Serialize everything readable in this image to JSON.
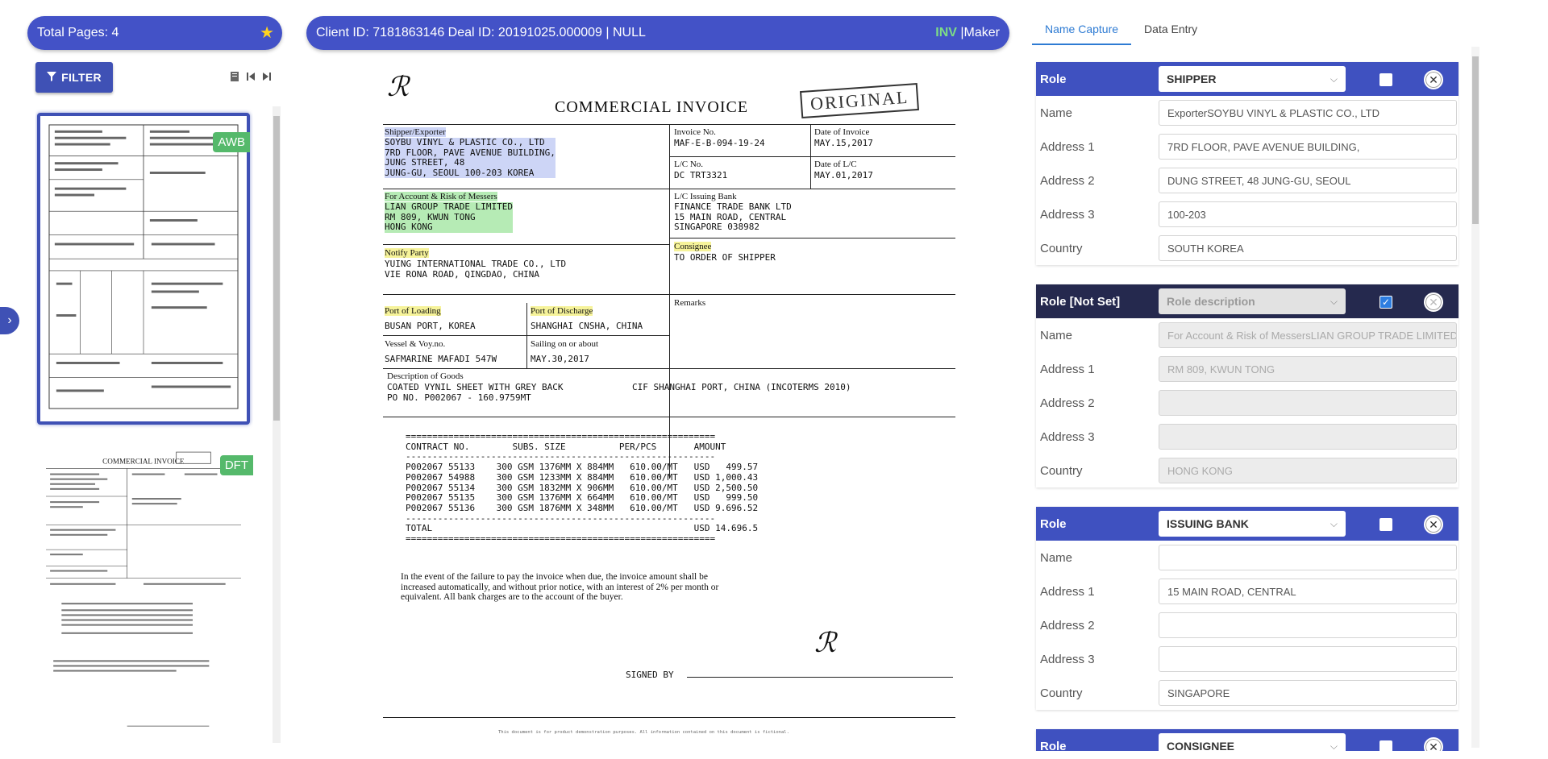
{
  "left": {
    "total_pages_label": "Total Pages: 4",
    "filter_label": "FILTER",
    "thumbnails": [
      {
        "badge": "AWB",
        "selected": true
      },
      {
        "badge": "DFT",
        "selected": false
      }
    ]
  },
  "header": {
    "client_info": "Client ID: 7181863146 Deal ID: 20191025.000009 | NULL",
    "doc_type": "INV",
    "separator": " |",
    "role": "Maker"
  },
  "document": {
    "title": "COMMERCIAL INVOICE",
    "stamp": "ORIGINAL",
    "shipper_label": "Shipper/Exporter",
    "shipper": "SOYBU VINYL & PLASTIC CO., LTD\n7RD FLOOR, PAVE AVENUE BUILDING,\nJUNG STREET, 48\nJUNG-GU, SEOUL 100-203 KOREA",
    "invoice_no_label": "Invoice No.",
    "invoice_no": "MAF-E-B-094-19-24",
    "date_label": "Date of Invoice",
    "date": "MAY.15,2017",
    "lc_no_label": "L/C No.",
    "lc_no": "DC TRT3321",
    "lc_date_label": "Date of L/C",
    "lc_date": "MAY.01,2017",
    "account_label": "For Account & Risk of Messers",
    "account": "LIAN GROUP TRADE LIMITED\nRM 809, KWUN TONG\nHONG KONG",
    "issuing_bank_label": "L/C Issuing Bank",
    "issuing_bank": "FINANCE TRADE BANK LTD\n15 MAIN ROAD, CENTRAL\nSINGAPORE 038982",
    "consignee_label": "Consignee",
    "consignee": "TO ORDER OF SHIPPER",
    "notify_label": "Notify Party",
    "notify": "YUING INTERNATIONAL TRADE CO., LTD\nVIE RONA ROAD, QINGDAO, CHINA",
    "remarks_label": "Remarks",
    "loading_label": "Port of Loading",
    "loading": "BUSAN PORT, KOREA",
    "discharge_label": "Port of Discharge",
    "discharge": "SHANGHAI CNSHA, CHINA",
    "vessel_label": "Vessel & Voy.no.",
    "vessel": "SAFMARINE MAFADI 547W",
    "sailing_label": "Sailing on or about",
    "sailing": "MAY.30,2017",
    "goods_label": "Description of Goods",
    "goods": "COATED VYNIL SHEET WITH GREY BACK\nPO NO. P002067 - 160.9759MT",
    "incoterms": "CIF SHANGHAI PORT, CHINA (INCOTERMS 2010)",
    "table": "==========================================================\nCONTRACT NO.        SUBS. SIZE          PER/PCS       AMOUNT\n----------------------------------------------------------\nP002067 55133    300 GSM 1376MM X 884MM   610.00/MT   USD   499.57\nP002067 54988    300 GSM 1233MM X 884MM   610.00/MT   USD 1,000.43\nP002067 55134    300 GSM 1832MM X 906MM   610.00/MT   USD 2,500.50\nP002067 55135    300 GSM 1376MM X 664MM   610.00/MT   USD   999.50\nP002067 55136    300 GSM 1876MM X 348MM   610.00/MT   USD 9.696.52\n----------------------------------------------------------\nTOTAL                                                 USD 14.696.5\n==========================================================",
    "terms": "In the event of the failure to pay the invoice when due, the invoice amount shall be\nincreased automatically, and without prior notice, with an interest of 2% per month or\nequivalent. All bank charges are to the account of the buyer.",
    "signed_by": "SIGNED BY",
    "footer": "This document is for product demonstration purposes. All information contained on this document is fictional."
  },
  "right": {
    "tabs": [
      "Name Capture",
      "Data Entry"
    ],
    "cards": [
      {
        "head": "Role",
        "select": "SHIPPER",
        "checked": false,
        "fields": [
          {
            "label": "Name",
            "value": "ExporterSOYBU VINYL & PLASTIC CO., LTD"
          },
          {
            "label": "Address 1",
            "value": "7RD FLOOR, PAVE AVENUE BUILDING,"
          },
          {
            "label": "Address 2",
            "value": "DUNG STREET, 48 JUNG-GU, SEOUL"
          },
          {
            "label": "Address 3",
            "value": "100-203"
          },
          {
            "label": "Country",
            "value": "SOUTH KOREA"
          }
        ]
      },
      {
        "head": "Role [Not Set]",
        "select": "Role description",
        "checked": true,
        "fields": [
          {
            "label": "Name",
            "value": "For Account & Risk of MessersLIAN GROUP TRADE LIMITED"
          },
          {
            "label": "Address 1",
            "value": "RM 809, KWUN TONG"
          },
          {
            "label": "Address 2",
            "value": ""
          },
          {
            "label": "Address 3",
            "value": ""
          },
          {
            "label": "Country",
            "value": "HONG KONG"
          }
        ]
      },
      {
        "head": "Role",
        "select": "ISSUING BANK",
        "checked": false,
        "fields": [
          {
            "label": "Name",
            "value": ""
          },
          {
            "label": "Address 1",
            "value": "15 MAIN ROAD, CENTRAL"
          },
          {
            "label": "Address 2",
            "value": ""
          },
          {
            "label": "Address 3",
            "value": ""
          },
          {
            "label": "Country",
            "value": "SINGAPORE"
          }
        ]
      },
      {
        "head": "Role",
        "select": "CONSIGNEE",
        "checked": false,
        "fields": []
      }
    ]
  },
  "colors": {
    "primary": "#3f51b5",
    "inv_green": "#7ddc86",
    "star": "#ffd320",
    "badge_green": "#55b96b",
    "dark_header": "#25294e"
  }
}
